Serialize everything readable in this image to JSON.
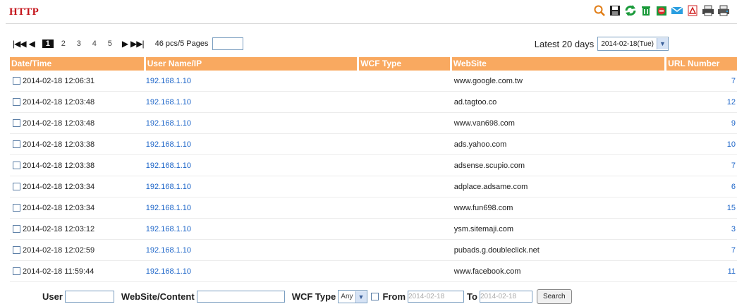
{
  "page": {
    "title": "HTTP"
  },
  "toolbar": {
    "icons": [
      "search-icon",
      "floppy-disk-icon",
      "refresh-icon",
      "trash-icon",
      "block-icon",
      "mail-icon",
      "pdf-icon",
      "print-icon",
      "print-all-icon"
    ]
  },
  "pager": {
    "first": "|◀◀",
    "prev": "◀",
    "pages": [
      "1",
      "2",
      "3",
      "4",
      "5"
    ],
    "active_page": "1",
    "next": "▶",
    "last": "▶▶|",
    "info": "46 pcs/5 Pages",
    "goto_value": ""
  },
  "latest": {
    "label": "Latest 20 days",
    "selected": "2014-02-18(Tue)"
  },
  "table": {
    "headers": [
      "Date/Time",
      "User Name/IP",
      "WCF Type",
      "WebSite",
      "URL Number"
    ],
    "rows": [
      {
        "datetime": "2014-02-18 12:06:31",
        "ip": "192.168.1.10",
        "wcf": "",
        "site": "www.google.com.tw",
        "url": "7"
      },
      {
        "datetime": "2014-02-18 12:03:48",
        "ip": "192.168.1.10",
        "wcf": "",
        "site": "ad.tagtoo.co",
        "url": "12"
      },
      {
        "datetime": "2014-02-18 12:03:48",
        "ip": "192.168.1.10",
        "wcf": "",
        "site": "www.van698.com",
        "url": "9"
      },
      {
        "datetime": "2014-02-18 12:03:38",
        "ip": "192.168.1.10",
        "wcf": "",
        "site": "ads.yahoo.com",
        "url": "10"
      },
      {
        "datetime": "2014-02-18 12:03:38",
        "ip": "192.168.1.10",
        "wcf": "",
        "site": "adsense.scupio.com",
        "url": "7"
      },
      {
        "datetime": "2014-02-18 12:03:34",
        "ip": "192.168.1.10",
        "wcf": "",
        "site": "adplace.adsame.com",
        "url": "6"
      },
      {
        "datetime": "2014-02-18 12:03:34",
        "ip": "192.168.1.10",
        "wcf": "",
        "site": "www.fun698.com",
        "url": "15"
      },
      {
        "datetime": "2014-02-18 12:03:12",
        "ip": "192.168.1.10",
        "wcf": "",
        "site": "ysm.sitemaji.com",
        "url": "3"
      },
      {
        "datetime": "2014-02-18 12:02:59",
        "ip": "192.168.1.10",
        "wcf": "",
        "site": "pubads.g.doubleclick.net",
        "url": "7"
      },
      {
        "datetime": "2014-02-18 11:59:44",
        "ip": "192.168.1.10",
        "wcf": "",
        "site": "www.facebook.com",
        "url": "11"
      }
    ]
  },
  "filters": {
    "user_label": "User",
    "user_value": "",
    "website_label": "WebSite/Content",
    "website_value": "",
    "wcf_label": "WCF Type",
    "wcf_selected": "Any",
    "from_label": "From",
    "from_value": "2014-02-18",
    "to_label": "To",
    "to_value": "2014-02-18",
    "search_label": "Search"
  },
  "colors": {
    "title": "#c4141b",
    "header_bg": "#f9a960",
    "link": "#1b64c8"
  }
}
